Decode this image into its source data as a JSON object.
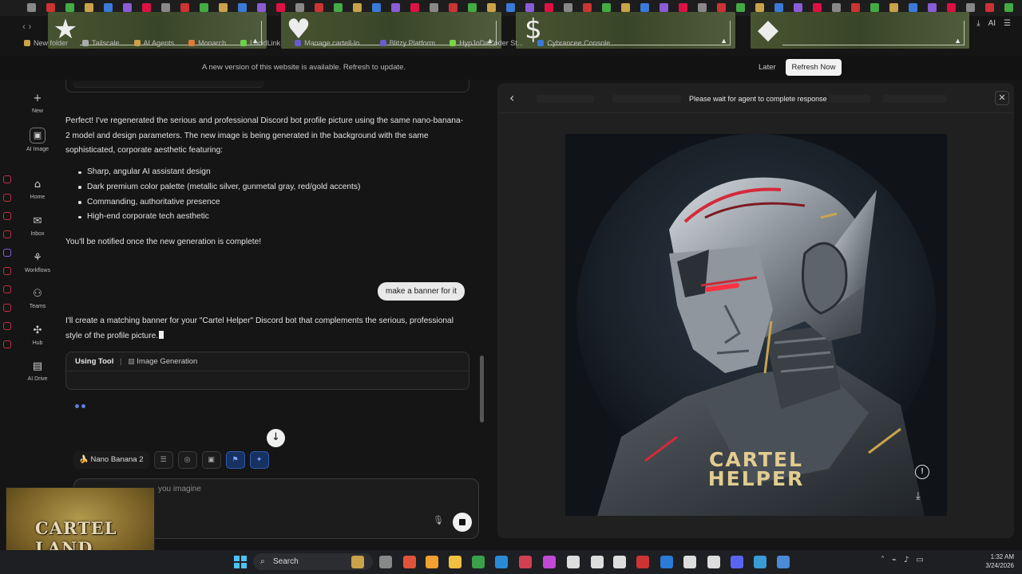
{
  "update_banner": {
    "message": "A new version of this website is available. Refresh to update.",
    "later_label": "Later",
    "refresh_label": "Refresh Now"
  },
  "browser": {
    "nav_arrows": "‹ ›",
    "ai_label": "AI",
    "overlay_shapes": [
      "★",
      "♥",
      "$",
      "◆"
    ],
    "bookmarks": [
      {
        "label": "New folder",
        "color": "#c9a24a"
      },
      {
        "label": "Tailscale",
        "color": "#aaaaaa"
      },
      {
        "label": "AI Agents",
        "color": "#c9a24a"
      },
      {
        "label": "Monarch",
        "color": "#e07a3a"
      },
      {
        "label": "LucidLink",
        "color": "#6bd14a"
      },
      {
        "label": "Manage cartell-lo...",
        "color": "#6a5acd"
      },
      {
        "label": "Blitzy Platform",
        "color": "#6a5acd"
      },
      {
        "label": "HypJoDaCoder St...",
        "color": "#7bd44a"
      },
      {
        "label": "Cybrancee Console",
        "color": "#3a7ad6"
      }
    ]
  },
  "left_nav": [
    {
      "icon": "+",
      "label": "New"
    },
    {
      "icon": "▣",
      "label": "AI Image"
    },
    {
      "icon": "⌂",
      "label": "Home"
    },
    {
      "icon": "✉",
      "label": "Inbox"
    },
    {
      "icon": "⚘",
      "label": "Workflows"
    },
    {
      "icon": "⚇",
      "label": "Teams"
    },
    {
      "icon": "✣",
      "label": "Hub"
    },
    {
      "icon": "▤",
      "label": "AI Drive"
    }
  ],
  "chat": {
    "ai_para1": "Perfect! I've regenerated the serious and professional Discord bot profile picture using the same nano-banana-2 model and design parameters. The new image is being generated in the background with the same sophisticated, corporate aesthetic featuring:",
    "bullets": [
      "Sharp, angular AI assistant design",
      "Dark premium color palette (metallic silver, gunmetal gray, red/gold accents)",
      "Commanding, authoritative presence",
      "High-end corporate tech aesthetic"
    ],
    "ai_para2": "You'll be notified once the new generation is complete!",
    "user_message": "make a banner for it",
    "ai_para3": "I'll create a matching banner for your \"Cartel Helper\" Discord bot that complements the serious, professional style of the profile picture.",
    "tool_card": {
      "using_label": "Using Tool",
      "separator": "|",
      "tool_name": "Image Generation"
    }
  },
  "composer": {
    "model_label": "Nano Banana 2",
    "placeholder_fragment": "you imagine"
  },
  "webcam": {
    "overlay_text": "CARTEL LAND"
  },
  "viewer": {
    "wait_message": "Please wait for agent to complete response",
    "image_text_line1": "CARTEL",
    "image_text_line2": "HELPER"
  },
  "taskbar": {
    "search_label": "Search",
    "time": "1:32 AM",
    "date": "3/24/2026"
  },
  "colors": {
    "accent_blue": "#2d5bb3",
    "refresh_button_bg": "#f2f2f2",
    "robot_accent_red": "#d32a3a",
    "robot_accent_gold": "#e2cd8f"
  }
}
